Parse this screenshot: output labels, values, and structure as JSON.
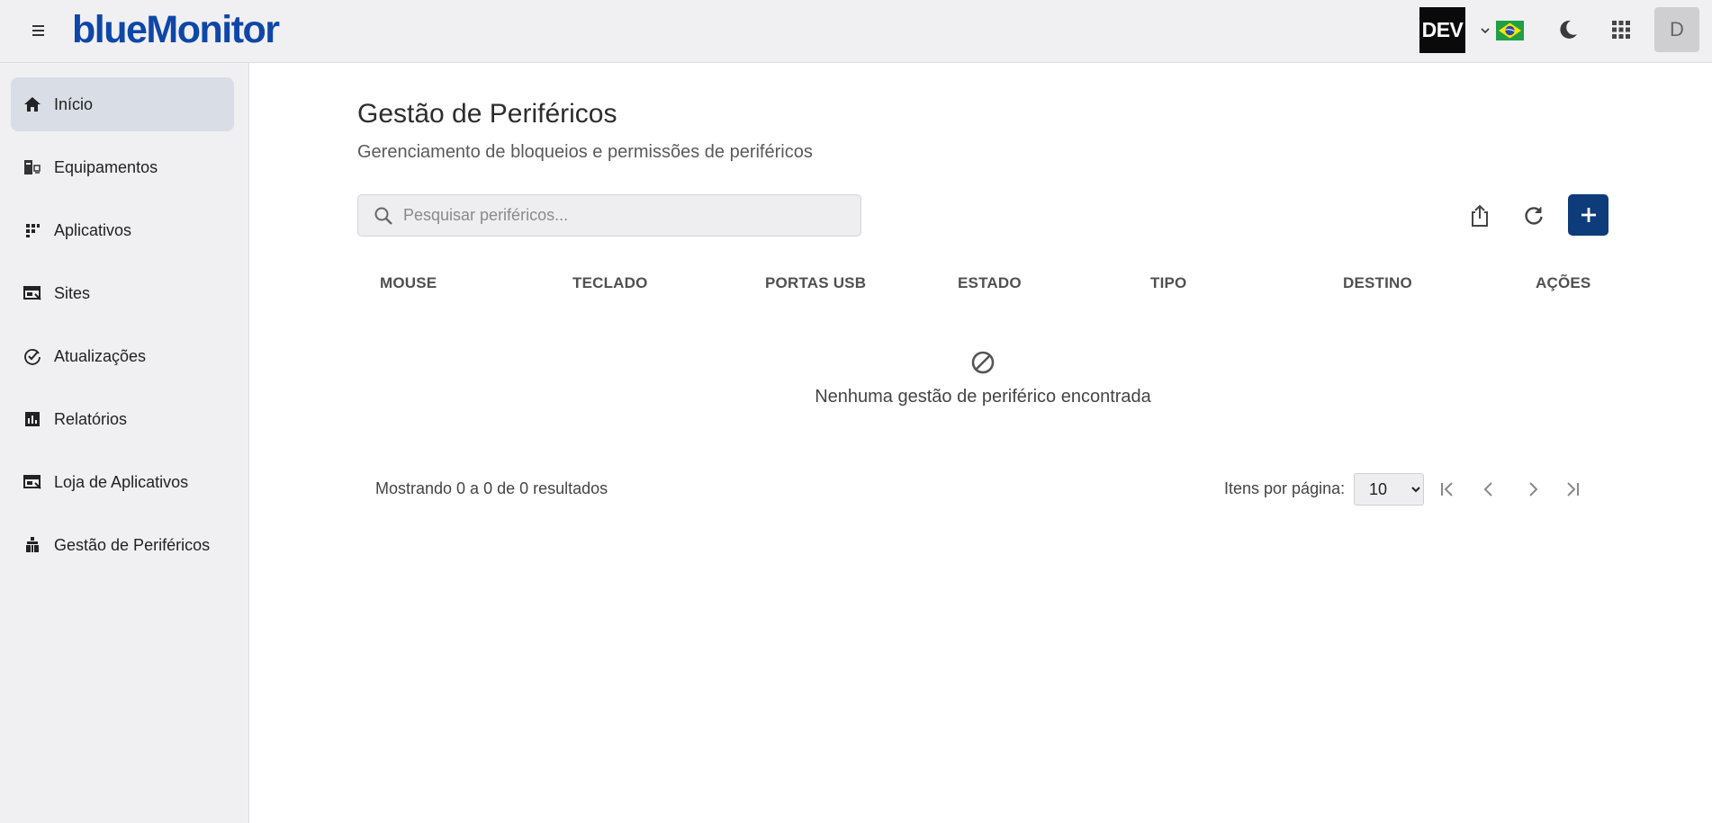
{
  "app": {
    "logo_text": "blueMonitor",
    "env_badge": "DEV",
    "user_initial": "D"
  },
  "icons": {
    "menu": "hamburger-icon",
    "language": "brazil-flag-icon",
    "theme": "moon-icon",
    "apps": "grid-icon"
  },
  "colors": {
    "brand": "#0f47a8",
    "primary_button": "#0e3b7a",
    "active_nav": "#d8dde6"
  },
  "sidebar": {
    "items": [
      {
        "label": "Início",
        "icon": "home-icon",
        "active": true
      },
      {
        "label": "Equipamentos",
        "icon": "devices-icon"
      },
      {
        "label": "Aplicativos",
        "icon": "apps-icon"
      },
      {
        "label": "Sites",
        "icon": "web-icon"
      },
      {
        "label": "Atualizações",
        "icon": "update-check-icon"
      },
      {
        "label": "Relatórios",
        "icon": "report-icon"
      },
      {
        "label": "Loja de Aplicativos",
        "icon": "store-icon"
      },
      {
        "label": "Gestão de Periféricos",
        "icon": "peripherals-icon"
      }
    ]
  },
  "main": {
    "title": "Gestão de Periféricos",
    "subtitle": "Gerenciamento de bloqueios e permissões de periféricos",
    "search_placeholder": "Pesquisar periféricos...",
    "add_label": "+",
    "columns": [
      "MOUSE",
      "TECLADO",
      "PORTAS USB",
      "ESTADO",
      "TIPO",
      "DESTINO",
      "AÇÕES"
    ],
    "empty_message": "Nenhuma gestão de periférico encontrada"
  },
  "pagination": {
    "summary": "Mostrando 0 a 0 de 0 resultados",
    "per_page_label": "Itens por página:",
    "per_page_value": "10"
  }
}
